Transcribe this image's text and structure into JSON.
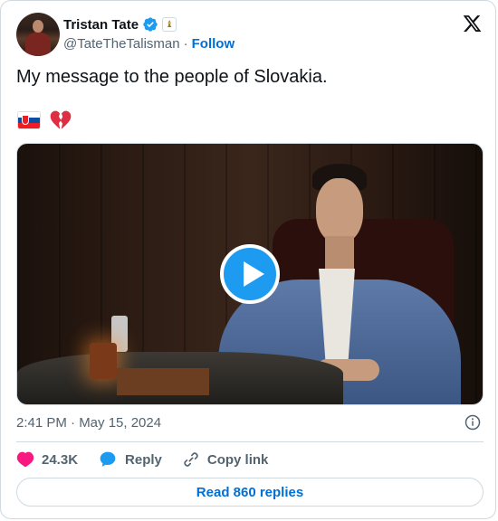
{
  "author": {
    "name": "Tristan Tate",
    "handle": "@TateTheTalisman",
    "separator": "·",
    "follow_label": "Follow"
  },
  "tweet": {
    "text": "My message to the people of Slovakia.",
    "timestamp": "2:41 PM · May 15, 2024"
  },
  "actions": {
    "likes": "24.3K",
    "reply_label": "Reply",
    "copy_label": "Copy link"
  },
  "read_replies_label": "Read 860 replies",
  "icons": {
    "verified": "verified-badge-icon",
    "affiliate": "affiliate-badge-icon",
    "x_logo": "x-logo-icon",
    "like": "heart-icon",
    "reply": "speech-bubble-icon",
    "copy": "link-icon",
    "info": "info-icon",
    "play": "play-icon"
  },
  "colors": {
    "accent": "#1d9bf0",
    "link": "#006fd6",
    "heart": "#f91880",
    "text": "#0f1419",
    "muted": "#536471"
  }
}
